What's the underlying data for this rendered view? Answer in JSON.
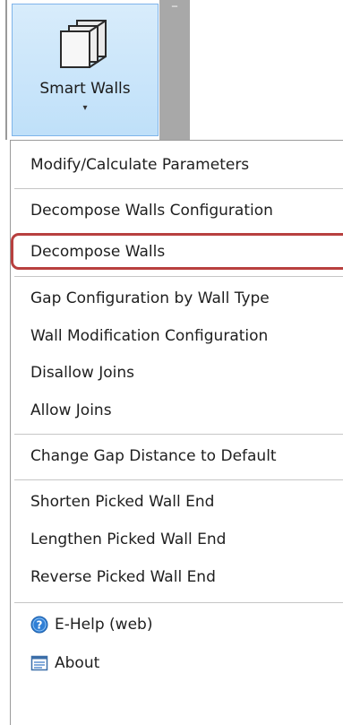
{
  "ribbon": {
    "button_label": "Smart Walls",
    "dropdown_arrow": "▾",
    "panel_pin_glyph": "‾",
    "button_icon": "walls-stack-icon"
  },
  "menu": {
    "items": [
      {
        "label": "Modify/Calculate Parameters"
      },
      {
        "label": "Decompose Walls Configuration"
      },
      {
        "label": "Decompose Walls"
      },
      {
        "label": "Gap Configuration by Wall Type"
      },
      {
        "label": "Wall Modification Configuration"
      },
      {
        "label": "Disallow Joins"
      },
      {
        "label": "Allow Joins"
      },
      {
        "label": "Change Gap Distance to Default"
      },
      {
        "label": "Shorten Picked Wall End"
      },
      {
        "label": "Lengthen Picked Wall End"
      },
      {
        "label": "Reverse Picked Wall End"
      },
      {
        "label": "E-Help (web)",
        "icon": "help-icon"
      },
      {
        "label": "About",
        "icon": "about-icon"
      }
    ],
    "highlighted_item": "Decompose Walls",
    "highlight_color": "#b8403f",
    "help_icon_color": "#2f7fd6"
  }
}
